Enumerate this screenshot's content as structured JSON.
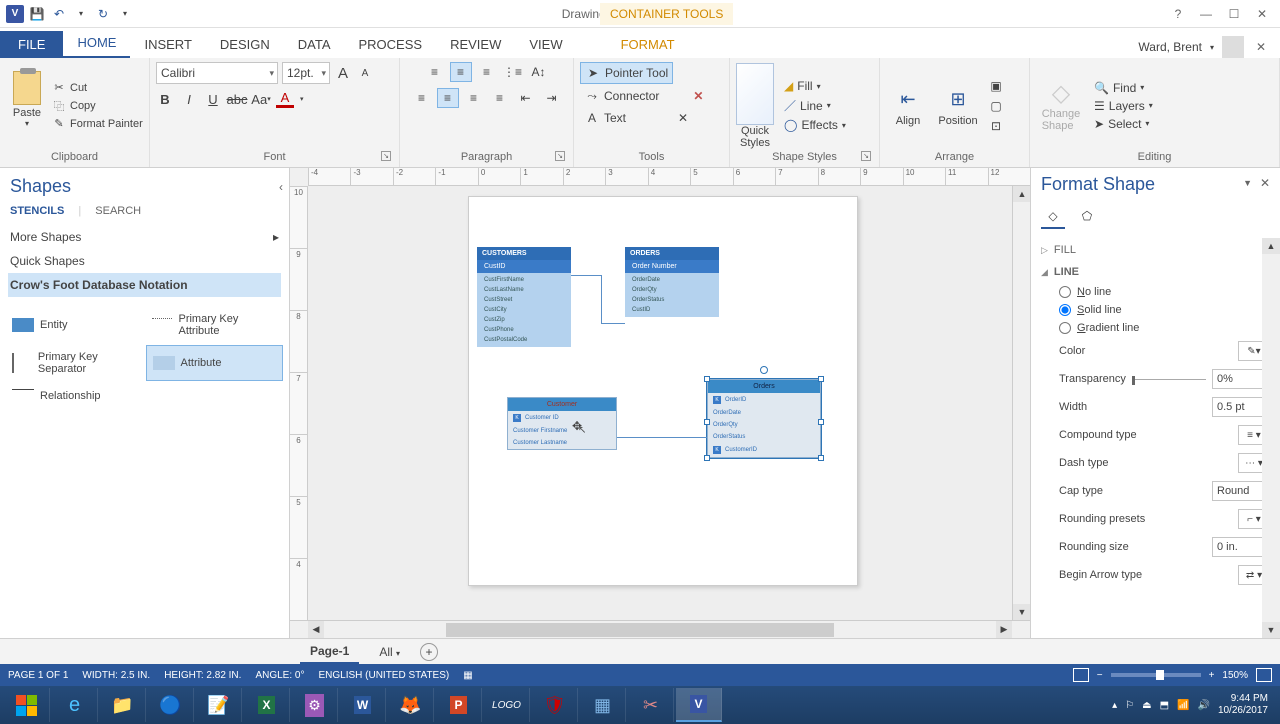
{
  "title": "Drawing1 - Visio Professional",
  "context_tab": "CONTAINER TOOLS",
  "user": "Ward, Brent",
  "tabs": {
    "file": "FILE",
    "home": "HOME",
    "insert": "INSERT",
    "design": "DESIGN",
    "data": "DATA",
    "process": "PROCESS",
    "review": "REVIEW",
    "view": "VIEW",
    "format": "FORMAT"
  },
  "ribbon": {
    "clipboard": {
      "label": "Clipboard",
      "paste": "Paste",
      "cut": "Cut",
      "copy": "Copy",
      "painter": "Format Painter"
    },
    "font": {
      "label": "Font",
      "name": "Calibri",
      "size": "12pt."
    },
    "paragraph": {
      "label": "Paragraph"
    },
    "tools": {
      "label": "Tools",
      "pointer": "Pointer Tool",
      "connector": "Connector",
      "text": "Text"
    },
    "shape_styles": {
      "label": "Shape Styles",
      "quick": "Quick\nStyles",
      "fill": "Fill",
      "line": "Line",
      "effects": "Effects"
    },
    "arrange": {
      "label": "Arrange",
      "align": "Align",
      "position": "Position"
    },
    "editing": {
      "label": "Editing",
      "change": "Change\nShape",
      "find": "Find",
      "layers": "Layers",
      "select": "Select"
    }
  },
  "shapes_pane": {
    "title": "Shapes",
    "tabs": {
      "stencils": "STENCILS",
      "search": "SEARCH"
    },
    "more": "More Shapes",
    "quick": "Quick Shapes",
    "current": "Crow's Foot Database Notation",
    "stencils": {
      "entity": "Entity",
      "pka": "Primary Key Attribute",
      "pks": "Primary Key Separator",
      "attr": "Attribute",
      "rel": "Relationship"
    }
  },
  "canvas": {
    "customers": {
      "title": "CUSTOMERS",
      "pk": "CustID",
      "rows": [
        "CustFirstName",
        "CustLastName",
        "CustStreet",
        "CustCity",
        "CustZip",
        "CustPhone",
        "CustPostalCode"
      ]
    },
    "orders": {
      "title": "ORDERS",
      "pk": "Order Number",
      "rows": [
        "OrderDate",
        "OrderQty",
        "OrderStatus",
        "CustID"
      ]
    },
    "customer2": {
      "title": "Customer",
      "rows": [
        "Customer ID",
        "Customer Firstname",
        "Customer Lastname"
      ]
    },
    "orders2": {
      "title": "Orders",
      "rows": [
        "OrderID",
        "OrderDate",
        "OrderQty",
        "OrderStatus",
        "CustomerID"
      ]
    }
  },
  "page_tabs": {
    "page1": "Page-1",
    "all": "All"
  },
  "format_pane": {
    "title": "Format Shape",
    "sections": {
      "fill": "FILL",
      "line": "LINE"
    },
    "line_opts": {
      "none": "No line",
      "solid": "Solid line",
      "grad": "Gradient line"
    },
    "props": {
      "color": "Color",
      "transparency": "Transparency",
      "width": "Width",
      "compound": "Compound type",
      "dash": "Dash type",
      "cap": "Cap type",
      "rounding_presets": "Rounding presets",
      "rounding_size": "Rounding size",
      "begin_arrow": "Begin Arrow type"
    },
    "vals": {
      "transparency": "0%",
      "width": "0.5 pt",
      "cap": "Round",
      "rounding_size": "0 in."
    }
  },
  "status": {
    "page": "PAGE 1 OF 1",
    "width": "WIDTH: 2.5 IN.",
    "height": "HEIGHT: 2.82 IN.",
    "angle": "ANGLE: 0°",
    "lang": "ENGLISH (UNITED STATES)",
    "zoom": "150%"
  },
  "clock": {
    "time": "9:44 PM",
    "date": "10/26/2017"
  }
}
